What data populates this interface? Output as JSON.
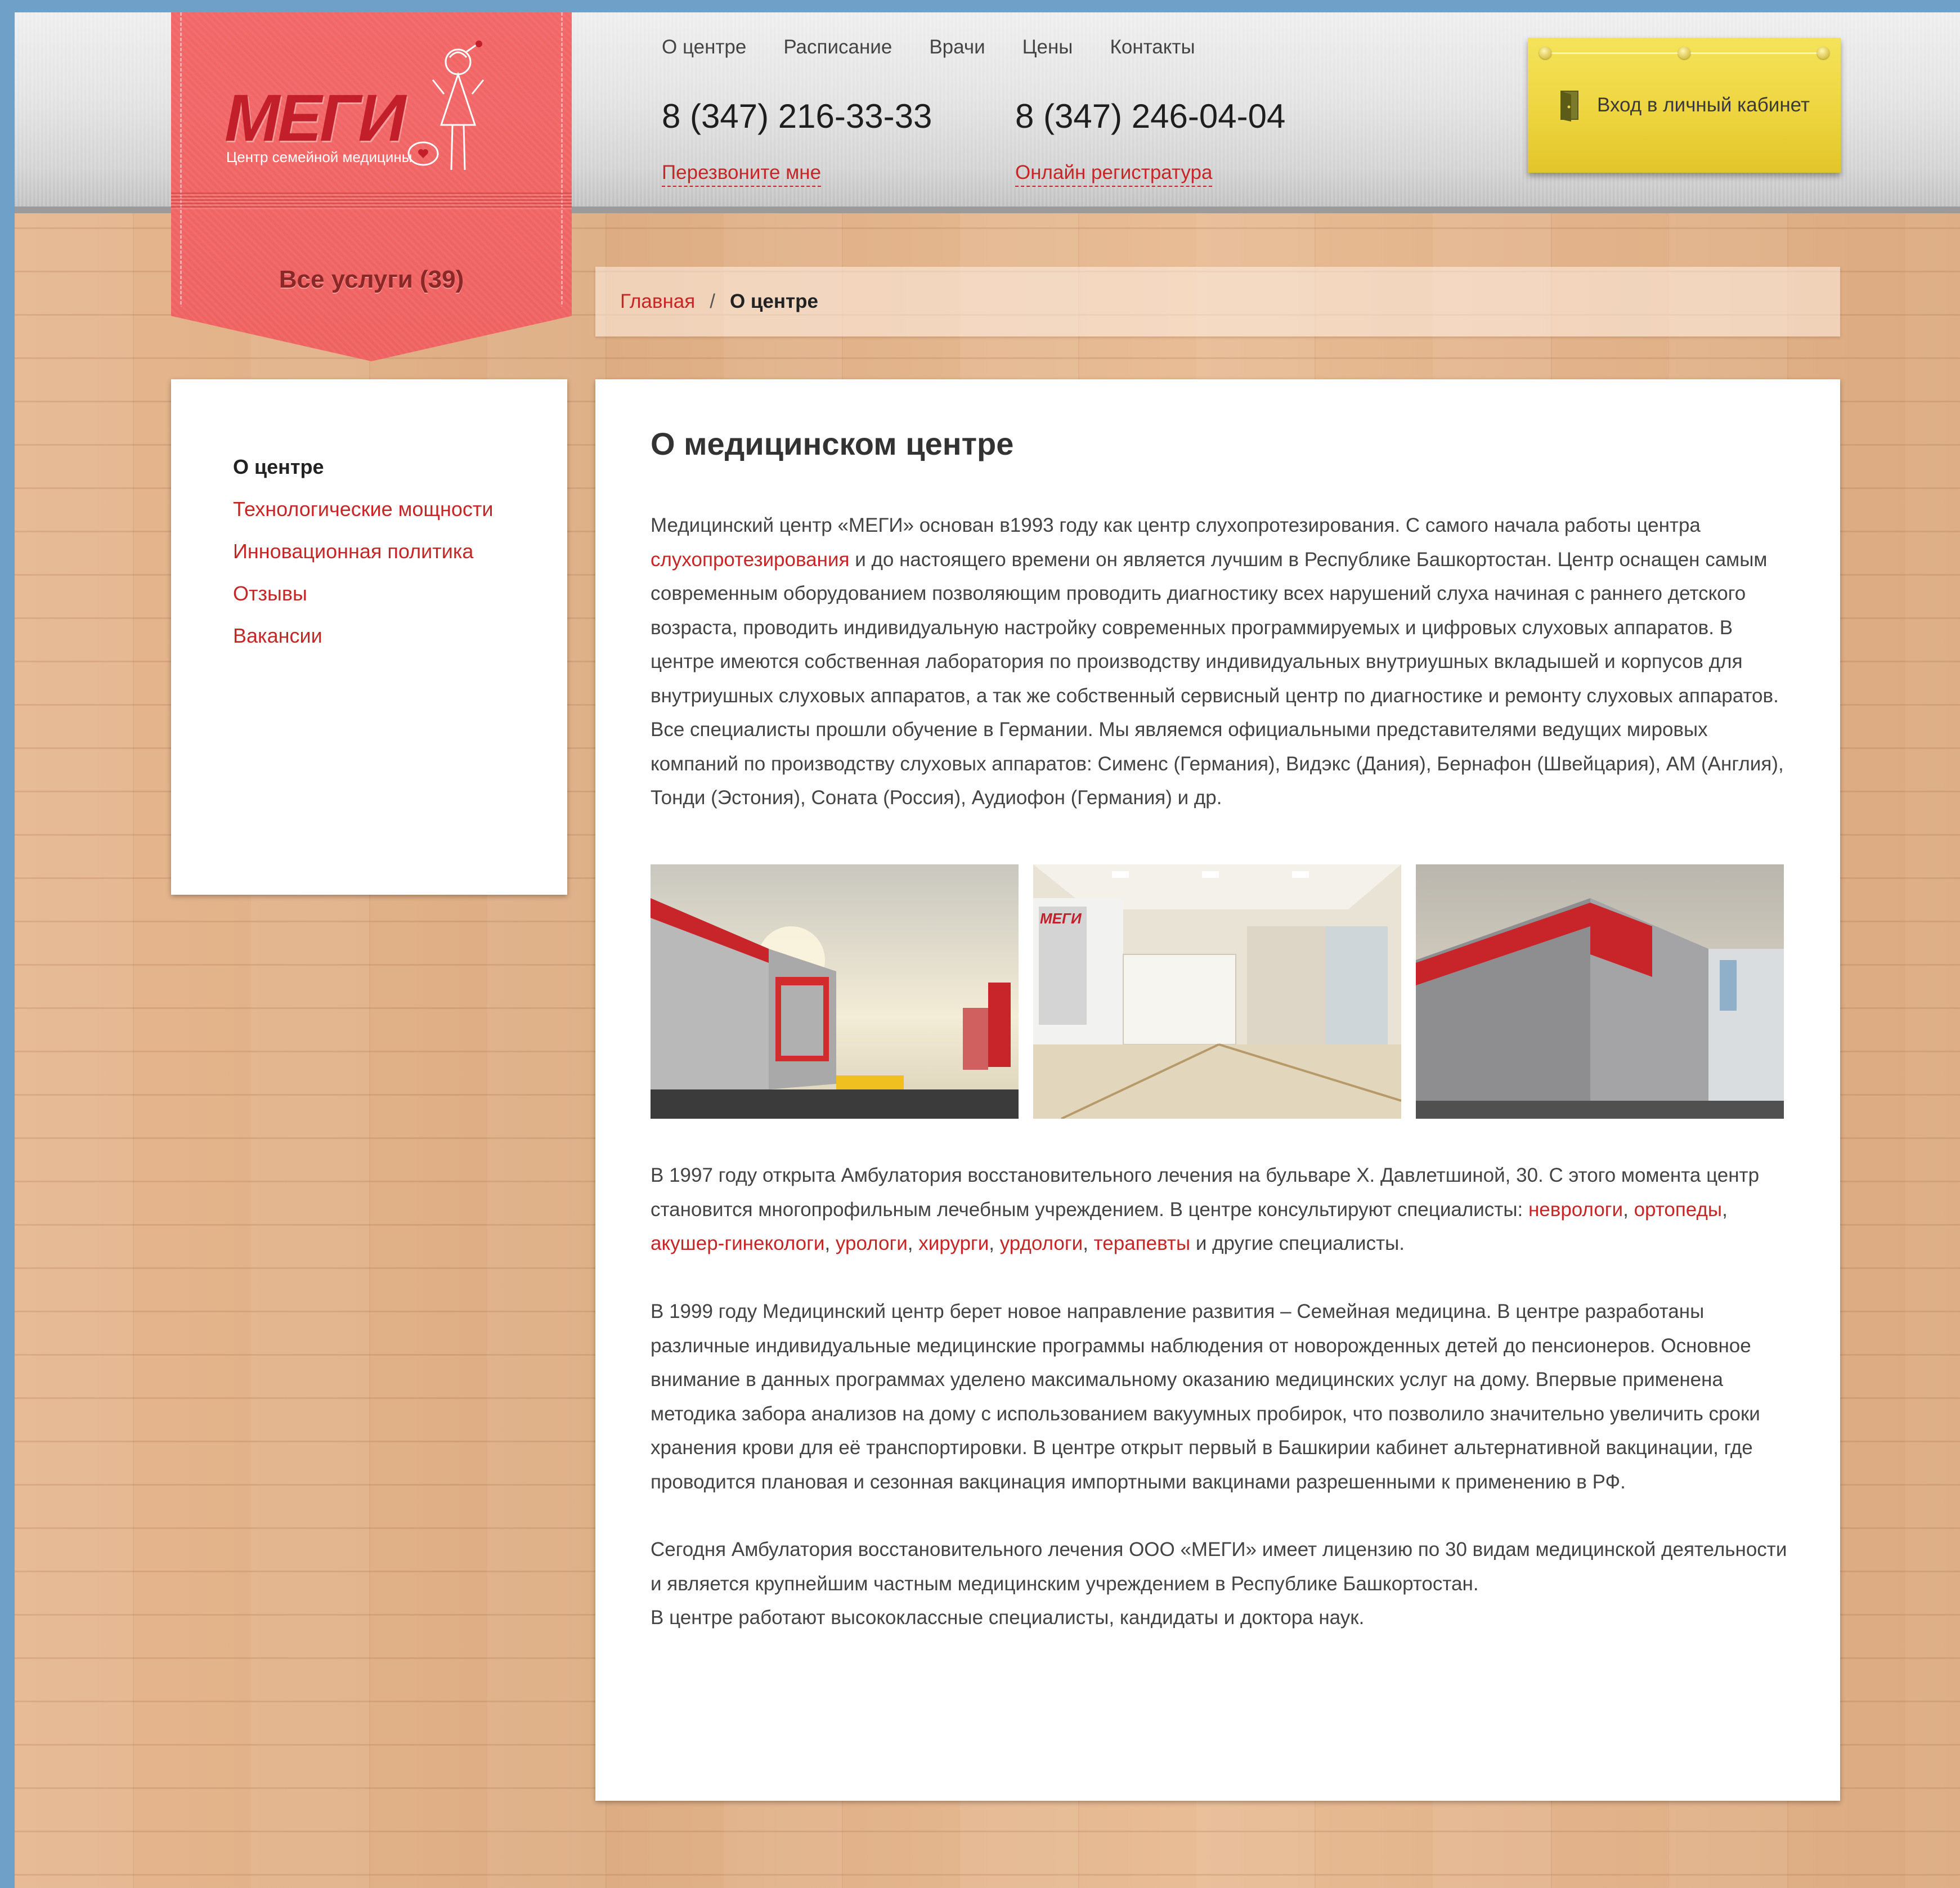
{
  "brand": {
    "logo_text": "МЕГИ",
    "tagline": "Центр семейной медицины",
    "services_label": "Все услуги (39)"
  },
  "nav": {
    "items": [
      {
        "label": "О центре"
      },
      {
        "label": "Расписание"
      },
      {
        "label": "Врачи"
      },
      {
        "label": "Цены"
      },
      {
        "label": "Контакты"
      }
    ]
  },
  "contacts": {
    "phone1": "8 (347) 216-33-33",
    "phone1_link": "Перезвоните мне",
    "phone2": "8 (347) 246-04-04",
    "phone2_link": "Онлайн регистратура"
  },
  "cabinet": {
    "label": "Вход в личный кабинет",
    "icon": "door-icon"
  },
  "breadcrumb": {
    "home": "Главная",
    "separator": "/",
    "current": "О центре"
  },
  "sidebar": {
    "items": [
      {
        "label": "О центре",
        "active": true
      },
      {
        "label": "Технологические мощности"
      },
      {
        "label": "Инновационная политика"
      },
      {
        "label": "Отзывы"
      },
      {
        "label": "Вакансии"
      }
    ]
  },
  "content": {
    "title": "О медицинском центре",
    "p1_a": "Медицинский центр «МЕГИ» основан в1993 году как центр слухопротезирования. С самого начала работы центра ",
    "p1_link": "слухопротезирования",
    "p1_b": " и до настоящего времени он является лучшим в Республике Башкортостан. Центр оснащен самым современным оборудованием позволяющим проводить диагностику всех нарушений слуха начиная с раннего детского возраста, проводить индивидуальную настройку современных программируемых и цифровых слуховых аппаратов. В центре имеются собственная лаборатория по производству индивидуальных внутриушных вкладышей и корпусов для внутриушных слуховых аппаратов, а так же собственный сервисный центр по диагностике и ремонту слуховых аппаратов. Все специалисты прошли обучение в Германии. Мы являемся официальными представителями ведущих мировых компаний по производству слуховых аппаратов: Сименс (Германия), Видэкс (Дания), Бернафон (Швейцария), АМ (Англия), Тонди (Эстония), Соната (Россия), Аудиофон (Германия) и др.",
    "p2_a": "В 1997 году открыта Амбулатория восстановительного лечения на бульваре Х. Давлетшиной, 30. С этого момента центр становится многопрофильным лечебным учреждением. В центре консультируют специалисты: ",
    "p2_links": [
      "неврологи",
      "ортопеды",
      "акушер-гинекологи",
      "урологи",
      "хирурги",
      "урдологи",
      "терапевты"
    ],
    "p2_b": " и другие специалисты.",
    "p3": "В 1999 году Медицинский центр берет новое направление развития – Семейная медицина. В центре разработаны различные индивидуальные медицинские программы наблюдения от новорожденных детей до пенсионеров. Основное внимание в данных программах уделено максимальному оказанию медицинских услуг на дому. Впервые применена методика забора анализов на дому с использованием вакуумных пробирок, что позволило значительно увеличить сроки хранения крови для её транспортировки. В центре открыт первый в Башкирии кабинет альтернативной вакцинации, где проводится плановая и сезонная вакцинация импортными вакцинами разрешенными к применению в РФ.",
    "p4_line1": "Сегодня Амбулатория восстановительного лечения ООО «МЕГИ» имеет лицензию по 30 видам медицинской деятельности и является крупнейшим частным медицинским учреждением в Республике Башкортостан.",
    "p4_line2": "В центре работают высококлассные специалисты, кандидаты и доктора наук."
  },
  "colors": {
    "accent": "#c72626",
    "ribbon": "#ef6262",
    "cabinet": "#eed53f",
    "wood": "#e3b48c"
  }
}
